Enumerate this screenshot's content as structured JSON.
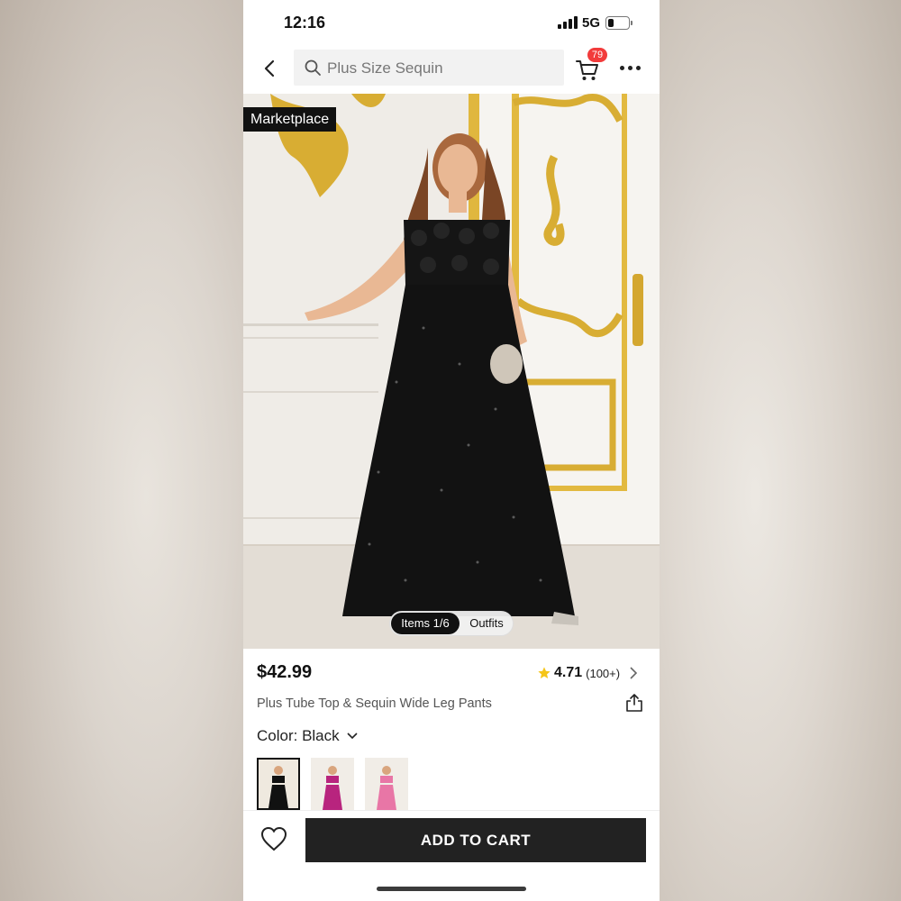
{
  "status_bar": {
    "time": "12:16",
    "network": "5G",
    "battery_level": 0.3
  },
  "nav": {
    "search_placeholder": "Plus Size Sequin",
    "cart_count": "79"
  },
  "product": {
    "marketplace_tag": "Marketplace",
    "gallery": {
      "items_label": "Items 1/6",
      "outfits_label": "Outfits"
    },
    "price": "$42.99",
    "rating": "4.71",
    "rating_count": "(100+)",
    "title": "Plus Tube Top & Sequin Wide Leg Pants",
    "color_label": "Color: Black",
    "swatches": [
      {
        "name": "Black",
        "color": "#111111",
        "selected": true
      },
      {
        "name": "Magenta",
        "color": "#b8247e",
        "selected": false
      },
      {
        "name": "Pink",
        "color": "#e876a6",
        "selected": false
      }
    ]
  },
  "actions": {
    "add_to_cart": "ADD TO CART"
  },
  "colors": {
    "badge": "#f23b3b",
    "star": "#f5c518",
    "button": "#222222"
  }
}
